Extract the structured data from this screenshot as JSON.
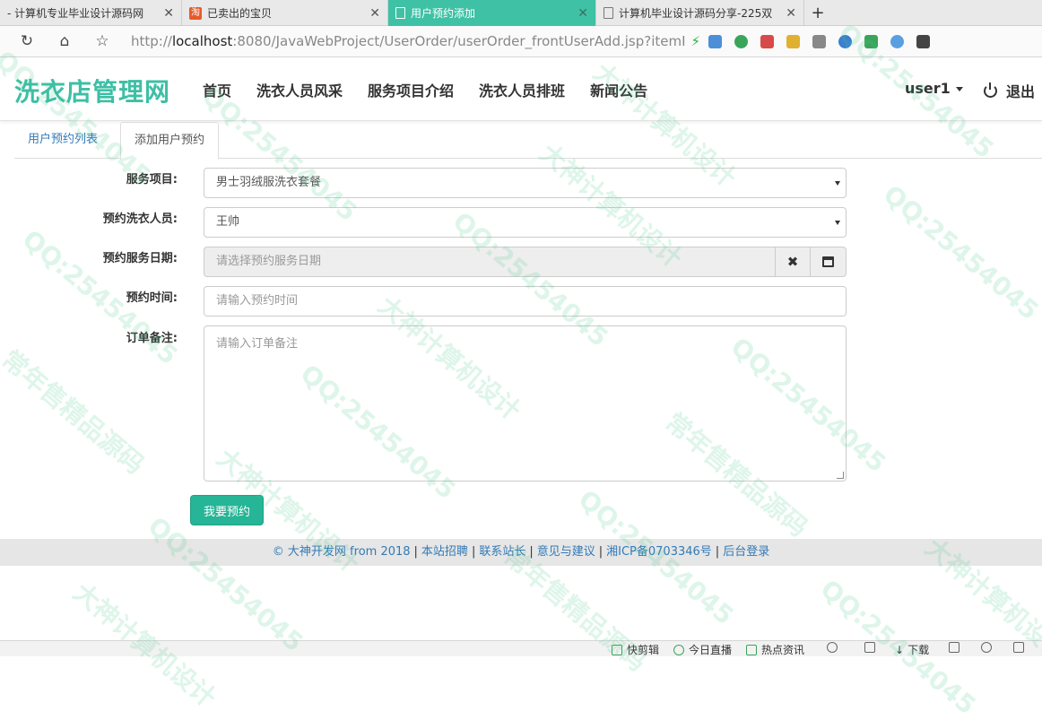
{
  "browser": {
    "tabs": [
      {
        "title": "- 计算机专业毕业设计源码网",
        "active": false,
        "icon": "none"
      },
      {
        "title": "已卖出的宝贝",
        "active": false,
        "icon": "taobao-icon"
      },
      {
        "title": "用户预约添加",
        "active": true,
        "icon": "page-icon"
      },
      {
        "title": "计算机毕业设计源码分享-225双",
        "active": false,
        "icon": "document-icon"
      }
    ],
    "new_tab_label": "+",
    "url_prefix": "http://",
    "url_host": "localhost",
    "url_rest": ":8080/JavaWebProject/UserOrder/userOrder_frontUserAdd.jsp?itemI"
  },
  "site": {
    "brand": "洗衣店管理网",
    "nav": [
      "首页",
      "洗衣人员风采",
      "服务项目介绍",
      "洗衣人员排班",
      "新闻公告"
    ],
    "user": "user1",
    "logout": "退出"
  },
  "page_tabs": {
    "list": "用户预约列表",
    "add": "添加用户预约"
  },
  "form": {
    "service_label": "服务项目:",
    "service_value": "男士羽绒服洗衣套餐",
    "worker_label": "预约洗衣人员:",
    "worker_value": "王帅",
    "date_label": "预约服务日期:",
    "date_placeholder": "请选择预约服务日期",
    "time_label": "预约时间:",
    "time_placeholder": "请输入预约时间",
    "note_label": "订单备注:",
    "note_placeholder": "请输入订单备注",
    "submit": "我要预约"
  },
  "footer": {
    "copyright": "© 大神开发网 from 2018",
    "links": [
      "本站招聘",
      "联系站长",
      "意见与建议",
      "湘ICP备0703346号",
      "后台登录"
    ]
  },
  "statusbar": {
    "items": [
      "快剪辑",
      "今日直播",
      "热点资讯",
      "下载"
    ]
  },
  "watermark": {
    "texts": [
      "QQ:25454045",
      "大神计算机设计",
      "常年售精品源码"
    ]
  },
  "colors": {
    "brand": "#3dbfa5",
    "active_tab": "#3fc1a5",
    "button": "#26b596",
    "link": "#337ab7"
  }
}
